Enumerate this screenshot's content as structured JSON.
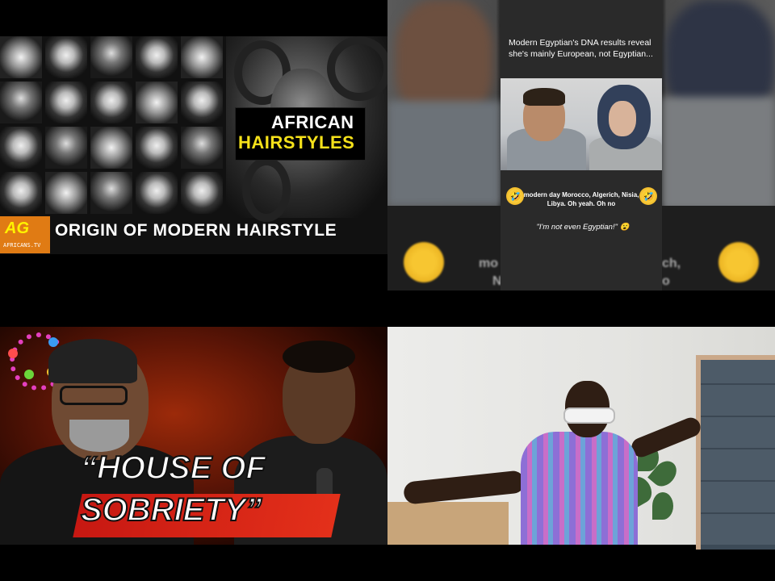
{
  "grid": {
    "tiles": [
      {
        "id": "tile-african-hairstyles",
        "title_line1": "AFRICAN",
        "title_line2": "HAIRSTYLES",
        "subtitle": "ORIGIN OF MODERN HAIRSTYLE",
        "logo_mark": "AG",
        "logo_sub": "AFRICANS.TV",
        "colors": {
          "accent": "#f5e11a",
          "logo_bg": "#e07b14"
        }
      },
      {
        "id": "tile-egyptian-dna",
        "caption": "Modern Egyptian's DNA results reveal she's mainly European, not Egyptian...",
        "emoji_left": "🤣",
        "emoji_right": "🤣",
        "subcaption": "modern day Morocco, Algerich, Nisia, Libya. Oh yeah. Oh no",
        "quote": "\"I'm not even Egyptian!\" 😮",
        "blur_left": "mo",
        "blur_left2": "N",
        "blur_right": "ch,",
        "blur_right2": "o"
      },
      {
        "id": "tile-house-of-sobriety",
        "title_line1": "“HOUSE OF",
        "title_line2": "SOBRIETY”",
        "colors": {
          "banner": "#d8231a"
        }
      },
      {
        "id": "tile-purple-shirt-man",
        "icons": [
          "sunglasses",
          "plant"
        ]
      }
    ]
  }
}
